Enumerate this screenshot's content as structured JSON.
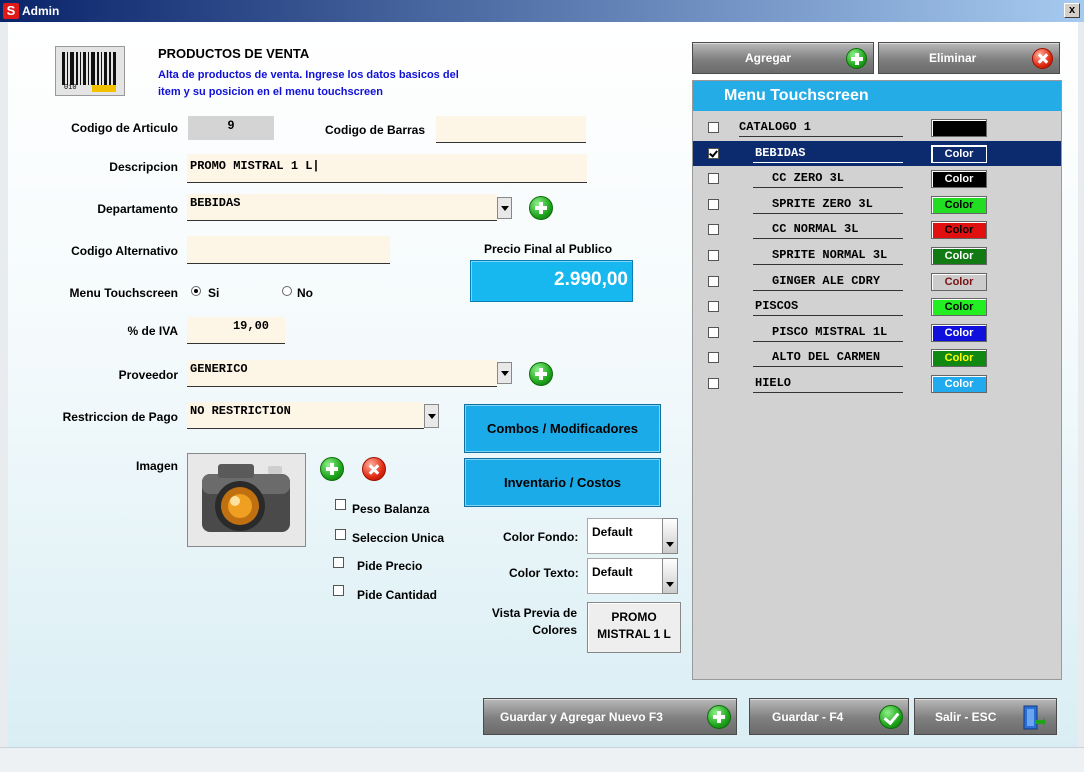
{
  "window": {
    "title": "Admin",
    "app_icon_glyph": "S",
    "close_glyph": "x"
  },
  "header": {
    "title": "PRODUCTOS DE VENTA",
    "subtitle_line1": "Alta de productos de venta. Ingrese los datos basicos del",
    "subtitle_line2": "item y su posicion en el menu touchscreen",
    "barcode_digits": "010"
  },
  "form": {
    "codigo_articulo_label": "Codigo de Articulo",
    "codigo_articulo_value": "9",
    "codigo_barras_label": "Codigo de Barras",
    "codigo_barras_value": "",
    "descripcion_label": "Descripcion",
    "descripcion_value": "PROMO MISTRAL 1 L|",
    "departamento_label": "Departamento",
    "departamento_value": "BEBIDAS",
    "codigo_alternativo_label": "Codigo Alternativo",
    "codigo_alternativo_value": "",
    "precio_label": "Precio Final al Publico",
    "precio_value": "2.990,00",
    "menu_touch_label": "Menu Touchscreen",
    "menu_touch_si": "Si",
    "menu_touch_no": "No",
    "menu_touch_selected": "Si",
    "iva_label": "% de IVA",
    "iva_value": "19,00",
    "proveedor_label": "Proveedor",
    "proveedor_value": "GENERICO",
    "restriccion_label": "Restriccion de Pago",
    "restriccion_value": "NO RESTRICTION",
    "imagen_label": "Imagen",
    "checkboxes": [
      {
        "label": "Peso Balanza",
        "checked": false
      },
      {
        "label": "Seleccion Unica",
        "checked": false
      },
      {
        "label": "Pide Precio",
        "checked": false
      },
      {
        "label": "Pide Cantidad",
        "checked": false
      }
    ],
    "color_fondo_label": "Color Fondo:",
    "color_fondo_value": "Default",
    "color_texto_label": "Color Texto:",
    "color_texto_value": "Default",
    "vista_previa_label_1": "Vista Previa de",
    "vista_previa_label_2": "Colores",
    "vista_previa_line1": "PROMO",
    "vista_previa_line2": "MISTRAL 1 L"
  },
  "buttons": {
    "combos": "Combos /  Modificadores",
    "inventario": "Inventario / Costos",
    "agregar": "Agregar",
    "eliminar": "Eliminar",
    "guardar_nuevo": "Guardar y Agregar Nuevo F3",
    "guardar": "Guardar - F4",
    "salir": "Salir - ESC"
  },
  "menu_touchscreen": {
    "title": "Menu Touchscreen",
    "items": [
      {
        "name": "CATALOGO 1",
        "level": 0,
        "checked": false,
        "selected": false,
        "swatch_label": "",
        "swatch_color": "#000000",
        "swatch_text_color": "#ffffff"
      },
      {
        "name": "BEBIDAS",
        "level": 1,
        "checked": true,
        "selected": true,
        "swatch_label": "Color",
        "swatch_color": "#0c2a6e",
        "swatch_text_color": "#ffffff"
      },
      {
        "name": "CC ZERO 3L",
        "level": 2,
        "checked": false,
        "selected": false,
        "swatch_label": "Color",
        "swatch_color": "#000000",
        "swatch_text_color": "#ffffff"
      },
      {
        "name": "SPRITE ZERO 3L",
        "level": 2,
        "checked": false,
        "selected": false,
        "swatch_label": "Color",
        "swatch_color": "#22dd22",
        "swatch_text_color": "#000000"
      },
      {
        "name": "CC NORMAL 3L",
        "level": 2,
        "checked": false,
        "selected": false,
        "swatch_label": "Color",
        "swatch_color": "#e01010",
        "swatch_text_color": "#000000"
      },
      {
        "name": "SPRITE NORMAL 3L",
        "level": 2,
        "checked": false,
        "selected": false,
        "swatch_label": "Color",
        "swatch_color": "#127a12",
        "swatch_text_color": "#ffffff"
      },
      {
        "name": "GINGER ALE CDRY",
        "level": 2,
        "checked": false,
        "selected": false,
        "swatch_label": "Color",
        "swatch_color": "#cccccc",
        "swatch_text_color": "#7a1010"
      },
      {
        "name": "PISCOS",
        "level": 1,
        "checked": false,
        "selected": false,
        "swatch_label": "Color",
        "swatch_color": "#22ee22",
        "swatch_text_color": "#000000"
      },
      {
        "name": "PISCO MISTRAL 1L",
        "level": 2,
        "checked": false,
        "selected": false,
        "swatch_label": "Color",
        "swatch_color": "#1010dd",
        "swatch_text_color": "#ffffff"
      },
      {
        "name": "ALTO DEL CARMEN",
        "level": 2,
        "checked": false,
        "selected": false,
        "swatch_label": "Color",
        "swatch_color": "#118811",
        "swatch_text_color": "#ffff00"
      },
      {
        "name": "HIELO",
        "level": 1,
        "checked": false,
        "selected": false,
        "swatch_label": "Color",
        "swatch_color": "#22aaee",
        "swatch_text_color": "#ffffff"
      }
    ]
  },
  "colors": {
    "accent_blue": "#1cabe9",
    "menu_header": "#24ace6",
    "selected_row": "#0c2a6e",
    "price_bg": "#17b7ef"
  }
}
